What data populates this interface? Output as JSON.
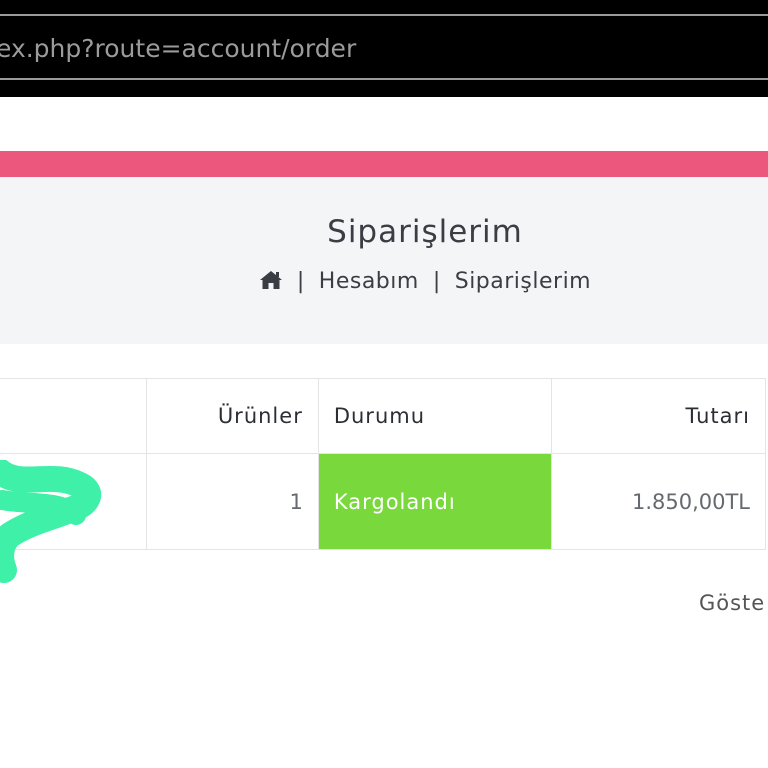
{
  "browser": {
    "url": "ex.php?route=account/order"
  },
  "colors": {
    "accent_bar": "#ec587d",
    "status_shipped": "#79d93c",
    "redaction": "#3ef0a8"
  },
  "header": {
    "title": "Siparişlerim",
    "breadcrumb": {
      "home_icon": "home-icon",
      "separator": "|",
      "items": [
        "Hesabım",
        "Siparişlerim"
      ]
    }
  },
  "orders_table": {
    "columns": [
      "",
      "Ürünler",
      "Durumu",
      "Tutarı"
    ],
    "rows": [
      {
        "order": "",
        "products": "1",
        "status": "Kargolandı",
        "total": "1.850,00TL"
      }
    ]
  },
  "pagination": {
    "showing_text": "Göste"
  }
}
